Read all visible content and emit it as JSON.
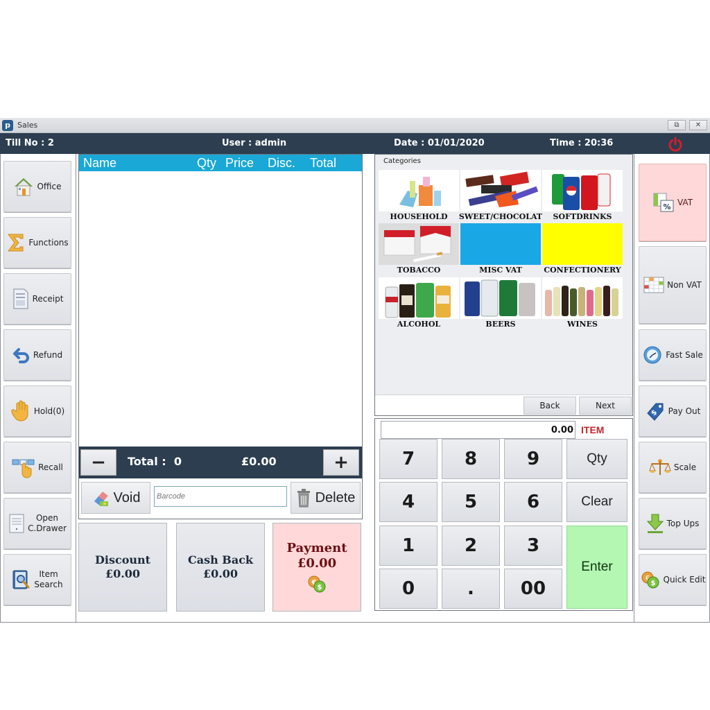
{
  "window": {
    "title": "Sales",
    "app_icon": "p-logo-icon",
    "controls": {
      "restore": "⧉",
      "close": "✕"
    }
  },
  "infobar": {
    "till": "Till No : 2",
    "user": "User : admin",
    "date": "Date : 01/01/2020",
    "time": "Time : 20:36",
    "power_icon": "power-icon",
    "power_color": "#d11f2a"
  },
  "left_sidebar": [
    {
      "label": "Office",
      "icon": "house-icon"
    },
    {
      "label": "Functions",
      "icon": "sigma-icon"
    },
    {
      "label": "Receipt",
      "icon": "document-icon"
    },
    {
      "label": "Refund",
      "icon": "undo-arrow-icon"
    },
    {
      "label": "Hold(0)",
      "icon": "hand-icon"
    },
    {
      "label": "Recall",
      "icon": "hand-pointer-icon"
    },
    {
      "label": "Open\nC.Drawer",
      "line1": "Open",
      "line2": "C.Drawer",
      "icon": "cash-drawer-icon"
    },
    {
      "label": "Item\nSearch",
      "line1": "Item",
      "line2": "Search",
      "icon": "book-search-icon"
    }
  ],
  "right_sidebar": [
    {
      "label": "VAT",
      "icon": "vat-percent-icon",
      "highlight": "#ffd9d9"
    },
    {
      "label": "Non VAT",
      "icon": "grid-table-icon"
    },
    {
      "label": "Fast Sale",
      "icon": "clock-refresh-icon"
    },
    {
      "label": "Pay Out",
      "icon": "price-tag-icon"
    },
    {
      "label": "Scale",
      "icon": "scale-icon"
    },
    {
      "label": "Top Ups",
      "icon": "download-arrow-icon"
    },
    {
      "label": "Quick Edit",
      "icon": "coins-icon"
    }
  ],
  "sales_grid": {
    "columns": [
      "Name",
      "Qty",
      "Price",
      "Disc.",
      "Total"
    ],
    "rows": [],
    "header_color": "#1aa8d6"
  },
  "totals": {
    "minus": "−",
    "plus": "+",
    "label": "Total :",
    "count": "0",
    "amount": "£0.00"
  },
  "actions": {
    "void": "Void",
    "barcode_placeholder": "Barcode",
    "barcode_value": "",
    "delete": "Delete"
  },
  "bottom_buttons": {
    "discount": {
      "label": "Discount",
      "value": "£0.00"
    },
    "cashback": {
      "label": "Cash Back",
      "value": "£0.00"
    },
    "payment": {
      "label": "Payment",
      "value": "£0.00",
      "color": "#ffd9d9"
    }
  },
  "categories": {
    "title": "Categories",
    "items": [
      {
        "label": "HOUSEHOLD",
        "image": "cleaning-products"
      },
      {
        "label": "SWEET/CHOCOLAT",
        "image": "chocolate-bars"
      },
      {
        "label": "SOFTDRINKS",
        "image": "soda-cans"
      },
      {
        "label": "TOBACCO",
        "image": "cigarette-packs"
      },
      {
        "label": "MISC VAT",
        "color": "#1aa7e6"
      },
      {
        "label": "CONFECTIONERY",
        "color": "#ffff00"
      },
      {
        "label": "ALCOHOL",
        "image": "spirit-bottles"
      },
      {
        "label": "BEERS",
        "image": "beer-cans"
      },
      {
        "label": "WINES",
        "image": "wine-bottles"
      }
    ],
    "back": "Back",
    "next": "Next"
  },
  "keypad": {
    "display": "0.00",
    "mode": "ITEM",
    "keys": [
      "7",
      "8",
      "9",
      "Qty",
      "4",
      "5",
      "6",
      "Clear",
      "1",
      "2",
      "3",
      "0",
      ".",
      "00"
    ],
    "enter": "Enter",
    "enter_color": "#b3f7b3"
  }
}
